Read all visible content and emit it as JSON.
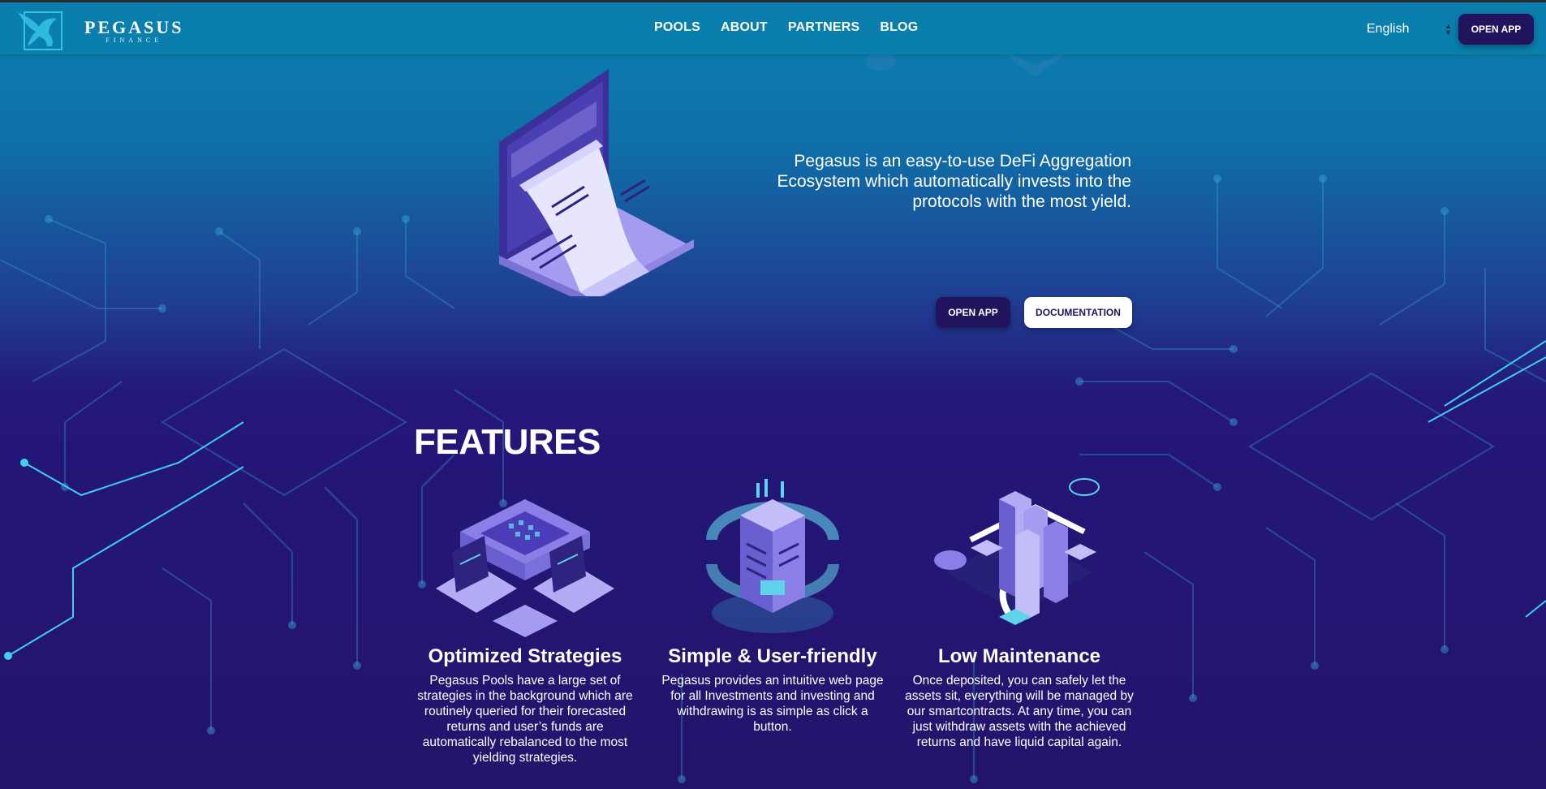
{
  "brand": {
    "name": "PEGASUS",
    "sub": "FINANCE"
  },
  "nav": {
    "links": [
      "POOLS",
      "ABOUT",
      "PARTNERS",
      "BLOG"
    ],
    "language": "English",
    "open_app": "OPEN APP"
  },
  "hero": {
    "text": "Pegasus is an easy-to-use DeFi Aggregation Ecosystem which automatically invests into the protocols with the most yield.",
    "open_app": "OPEN APP",
    "documentation": "DOCUMENTATION"
  },
  "features": {
    "title": "FEATURES",
    "items": [
      {
        "title": "Optimized Strategies",
        "text": "Pegasus Pools have a large set of strategies in the background which are routinely queried for their forecasted returns and user’s funds are automatically rebalanced to the most yielding strategies."
      },
      {
        "title": "Simple & User-friendly",
        "text": "Pegasus provides an intuitive web page for all Investments and investing and withdrawing is as simple as click a button."
      },
      {
        "title": "Low Maintenance",
        "text": "Once deposited, you can safely let the assets sit, everything will be managed by our smartcontracts. At any time, you can just withdraw assets with the achieved returns and have liquid capital again."
      }
    ]
  },
  "colors": {
    "nav": "#0a7fae",
    "deep": "#23146b",
    "button_dark": "#22135f",
    "accent": "#3cc7e6"
  }
}
